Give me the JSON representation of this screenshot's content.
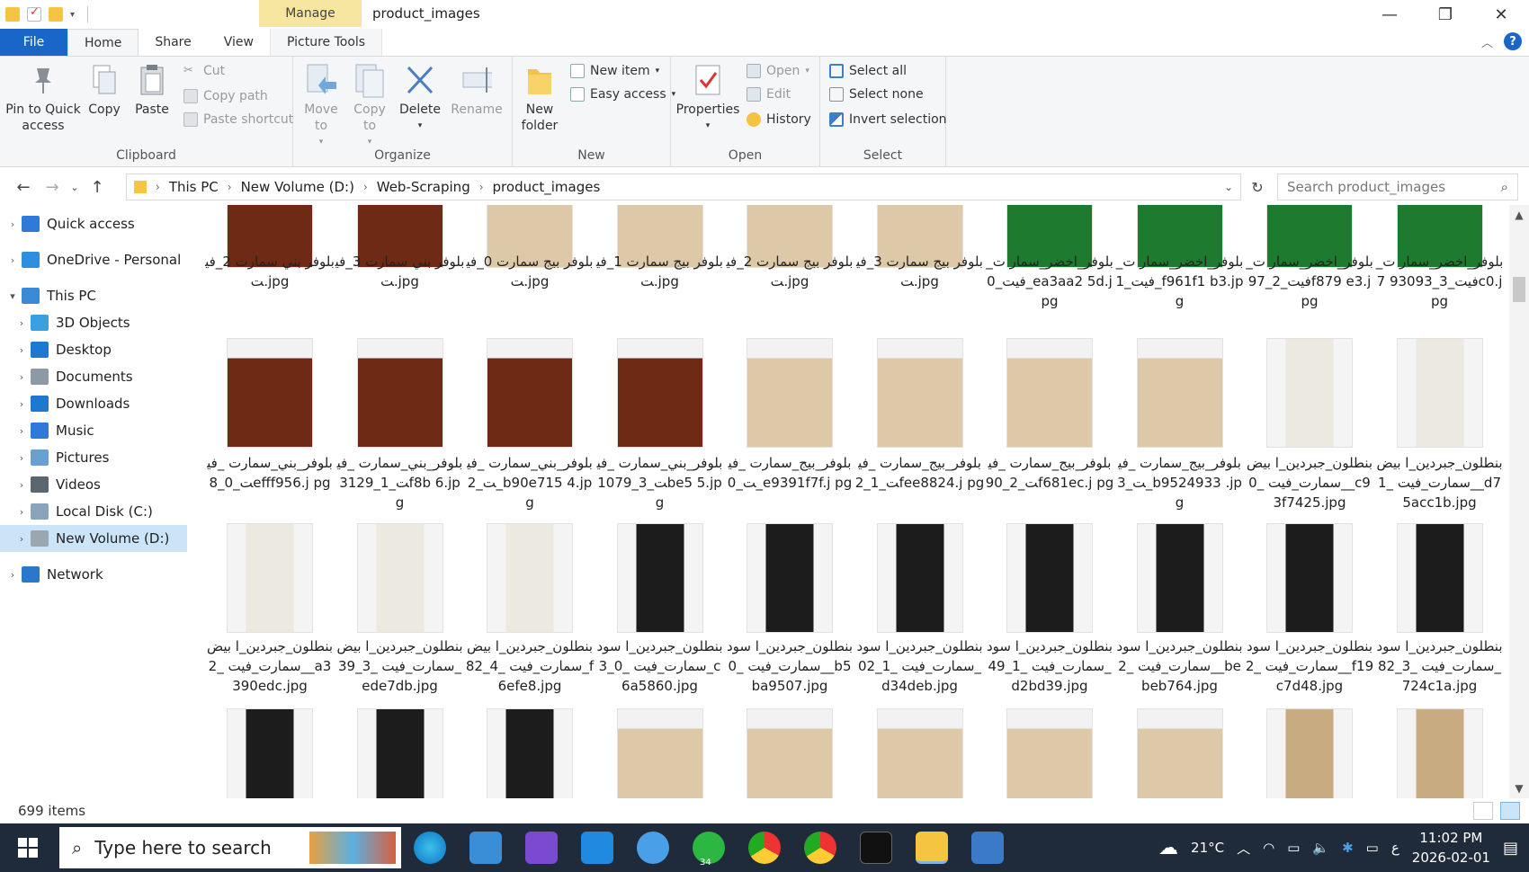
{
  "window": {
    "title": "product_images",
    "context_tab": "Manage",
    "controls": {
      "minimize": "—",
      "restore": "❐",
      "close": "✕"
    }
  },
  "tabs": [
    "File",
    "Home",
    "Share",
    "View",
    "Picture Tools"
  ],
  "ribbon": {
    "clipboard": {
      "label": "Clipboard",
      "pin": "Pin to Quick access",
      "copy": "Copy",
      "paste": "Paste",
      "cut": "Cut",
      "copy_path": "Copy path",
      "paste_shortcut": "Paste shortcut"
    },
    "organize": {
      "label": "Organize",
      "move_to": "Move to",
      "copy_to": "Copy to",
      "delete": "Delete",
      "rename": "Rename"
    },
    "new": {
      "label": "New",
      "new_folder": "New folder",
      "new_item": "New item",
      "easy_access": "Easy access"
    },
    "open": {
      "label": "Open",
      "properties": "Properties",
      "open": "Open",
      "edit": "Edit",
      "history": "History"
    },
    "select": {
      "label": "Select",
      "select_all": "Select all",
      "select_none": "Select none",
      "invert": "Invert selection"
    }
  },
  "address": {
    "crumbs": [
      "This PC",
      "New Volume (D:)",
      "Web-Scraping",
      "product_images"
    ],
    "search_placeholder": "Search product_images"
  },
  "nav": [
    {
      "label": "Quick access",
      "icon": "star-icon",
      "color": "#2f7ad8",
      "indent": 0
    },
    {
      "label": "OneDrive - Personal",
      "icon": "cloud-icon",
      "color": "#2e8fe0",
      "indent": 0
    },
    {
      "label": "This PC",
      "icon": "computer-icon",
      "color": "#3b8ad6",
      "indent": 0,
      "expanded": true
    },
    {
      "label": "3D Objects",
      "icon": "cube-icon",
      "color": "#3aa0e0",
      "indent": 1
    },
    {
      "label": "Desktop",
      "icon": "desktop-icon",
      "color": "#1e78d0",
      "indent": 1
    },
    {
      "label": "Documents",
      "icon": "document-icon",
      "color": "#8c9aa8",
      "indent": 1
    },
    {
      "label": "Downloads",
      "icon": "download-icon",
      "color": "#1e78d0",
      "indent": 1
    },
    {
      "label": "Music",
      "icon": "music-icon",
      "color": "#2f7ad8",
      "indent": 1
    },
    {
      "label": "Pictures",
      "icon": "pictures-icon",
      "color": "#6aa0d0",
      "indent": 1
    },
    {
      "label": "Videos",
      "icon": "videos-icon",
      "color": "#5a6670",
      "indent": 1
    },
    {
      "label": "Local Disk (C:)",
      "icon": "drive-icon",
      "color": "#8aa4bc",
      "indent": 1
    },
    {
      "label": "New Volume (D:)",
      "icon": "drive-icon",
      "color": "#9aa6b0",
      "indent": 1,
      "selected": true
    },
    {
      "label": "Network",
      "icon": "network-icon",
      "color": "#2a78c8",
      "indent": 0
    }
  ],
  "files_rows": [
    [
      {
        "name": "بلوفر بني سمارت 2_فيت.jpg",
        "kind": "brown"
      },
      {
        "name": "بلوفر بني سمارت 3_فيت.jpg",
        "kind": "brown"
      },
      {
        "name": "بلوفر بيج سمارت 0_فيت.jpg",
        "kind": "beige"
      },
      {
        "name": "بلوفر بيج سمارت 1_فيت.jpg",
        "kind": "beige"
      },
      {
        "name": "بلوفر بيج سمارت 2_فيت.jpg",
        "kind": "beige"
      },
      {
        "name": "بلوفر بيج سمارت 3_فيت.jpg",
        "kind": "beige"
      },
      {
        "name": "بلوفر_اخضر_سمار ت_فيت_0_ea3aa2 5d.jpg",
        "kind": "green"
      },
      {
        "name": "بلوفر_اخضر_سمار ت_فيت_1_f961f1 b3.jpg",
        "kind": "green"
      },
      {
        "name": "بلوفر_اخضر_سمار ت_فيت_2_97f879 e3.jpg",
        "kind": "green"
      },
      {
        "name": "بلوفر_اخضر_سمار ت_فيت_3_93093 7c0.jpg",
        "kind": "green"
      }
    ],
    [
      {
        "name": "بلوفر_بني_سمارت _فيت_0_8efff956.j pg",
        "kind": "brown"
      },
      {
        "name": "بلوفر_بني_سمارت _فيت_1_3129f8b 6.jpg",
        "kind": "brown"
      },
      {
        "name": "بلوفر_بني_سمارت _فيت_2_b90e715 4.jpg",
        "kind": "brown"
      },
      {
        "name": "بلوفر_بني_سمارت _فيت_3_1079be5 5.jpg",
        "kind": "brown"
      },
      {
        "name": "بلوفر_بيج_سمارت _فيت_0_e9391f7f.j pg",
        "kind": "beige"
      },
      {
        "name": "بلوفر_بيج_سمارت _فيت_1_2fee8824.j pg",
        "kind": "beige"
      },
      {
        "name": "بلوفر_بيج_سمارت _فيت_2_90f681ec.j pg",
        "kind": "beige"
      },
      {
        "name": "بلوفر_بيج_سمارت _فيت_3_b9524933 .jpg",
        "kind": "beige"
      },
      {
        "name": "بنطلون_جبردين_ا بيض_سمارت_فيت _0_c93f7425.jpg",
        "kind": "white"
      },
      {
        "name": "بنطلون_جبردين_ا بيض_سمارت_فيت _1_d75acc1b.jpg",
        "kind": "white"
      }
    ],
    [
      {
        "name": "بنطلون_جبردين_ا بيض_سمارت_فيت _2_a3390edc.jpg",
        "kind": "white"
      },
      {
        "name": "بنطلون_جبردين_ا بيض_سمارت_فيت _3_39ede7db.jpg",
        "kind": "white"
      },
      {
        "name": "بنطلون_جبردين_ا بيض_سمارت_فيت _4_82f6efe8.jpg",
        "kind": "white"
      },
      {
        "name": "بنطلون_جبردين_ا سود_سمارت_فيت _0_3c6a5860.jpg",
        "kind": "black"
      },
      {
        "name": "بنطلون_جبردين_ا سود_سمارت_فيت _0_b5ba9507.jpg",
        "kind": "black"
      },
      {
        "name": "بنطلون_جبردين_ا سود_سمارت_فيت _1_02d34deb.jpg",
        "kind": "black"
      },
      {
        "name": "بنطلون_جبردين_ا سود_سمارت_فيت _1_49d2bd39.jpg",
        "kind": "black"
      },
      {
        "name": "بنطلون_جبردين_ا سود_سمارت_فيت _2_bebeb764.jpg",
        "kind": "black"
      },
      {
        "name": "بنطلون_جبردين_ا سود_سمارت_فيت _2_f19c7d48.jpg",
        "kind": "black"
      },
      {
        "name": "بنطلون_جبردين_ا سود_سمارت_فيت _3_82724c1a.jpg",
        "kind": "black"
      }
    ],
    [
      {
        "name": "",
        "kind": "black"
      },
      {
        "name": "",
        "kind": "black"
      },
      {
        "name": "",
        "kind": "black"
      },
      {
        "name": "",
        "kind": "beige"
      },
      {
        "name": "",
        "kind": "beige"
      },
      {
        "name": "",
        "kind": "beige"
      },
      {
        "name": "",
        "kind": "beige"
      },
      {
        "name": "",
        "kind": "beige"
      },
      {
        "name": "",
        "kind": "khaki"
      },
      {
        "name": "",
        "kind": "khaki"
      }
    ]
  ],
  "thumb_colors": {
    "brown": "#6e2a14",
    "beige": "#ddc9a8",
    "green": "#1d7a2e",
    "white": "#ece9e0",
    "black": "#1c1c1c",
    "khaki": "#c9ab82"
  },
  "status": {
    "items": "699 items"
  },
  "taskbar": {
    "search_placeholder": "Type here to search",
    "weather": "21°C",
    "time": "11:02 PM",
    "date": "2026-02-01",
    "lang": "ع",
    "badge": "34"
  },
  "colors": {
    "accent": "#1a66c8",
    "selection": "#cce4f7",
    "manage": "#f6e6a0"
  }
}
